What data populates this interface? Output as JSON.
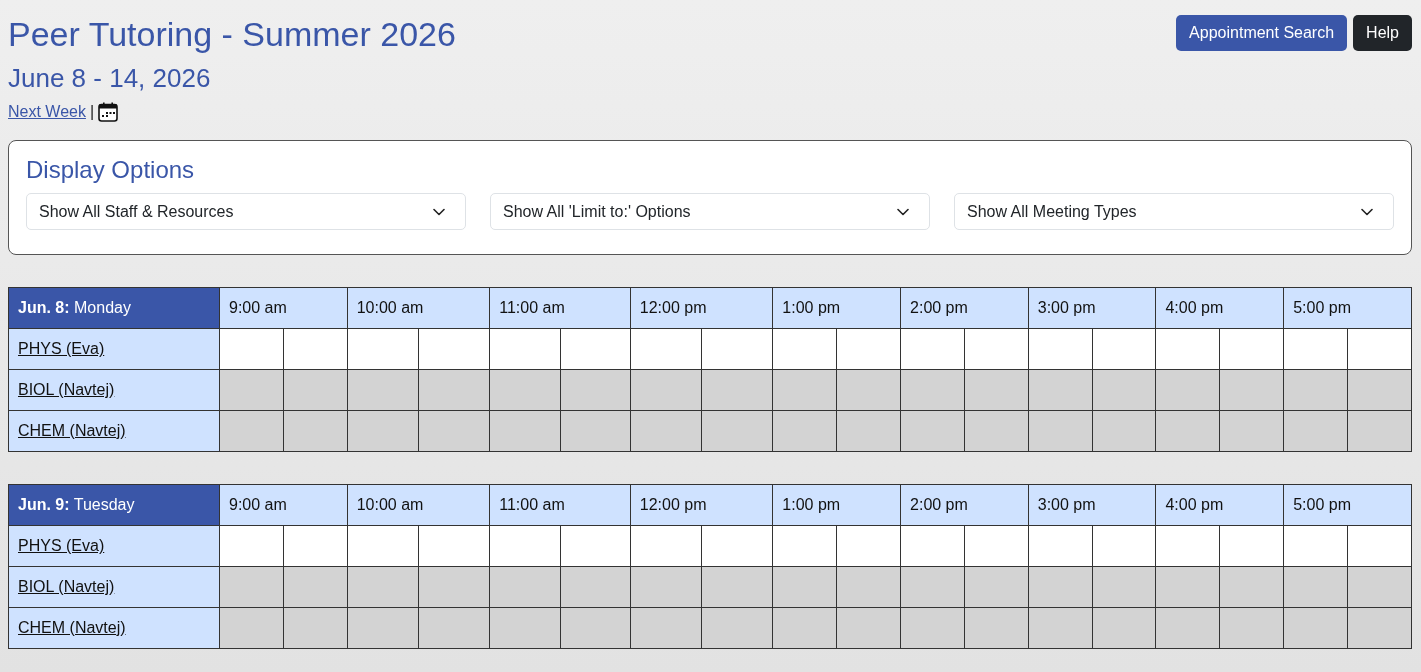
{
  "header": {
    "title": "Peer Tutoring - Summer 2026",
    "date_range": "June 8 - 14, 2026",
    "nav_link": "Next Week",
    "separator": "|"
  },
  "buttons": [
    {
      "label": "Appointment Search",
      "kind": "primary"
    },
    {
      "label": "Help",
      "kind": "dark"
    }
  ],
  "display_options": {
    "title": "Display Options",
    "filters": [
      {
        "value": "Show All Staff & Resources"
      },
      {
        "value": "Show All 'Limit to:' Options"
      },
      {
        "value": "Show All Meeting Types"
      }
    ]
  },
  "days": [
    {
      "date_label": "**Jun. 8:** Monday",
      "times": [
        "9:00 am",
        "10:00 am",
        "11:00 am",
        "12:00 pm",
        "1:00 pm",
        "2:00 pm",
        "3:00 pm",
        "4:00 pm",
        "5:00 pm"
      ],
      "rows": [
        {
          "label": "PHYS (Eva)",
          "slots": [
            {
              "available": true
            },
            {
              "available": true
            },
            {
              "available": true
            },
            {
              "available": true
            },
            {
              "available": true
            },
            {
              "available": true
            },
            {
              "available": true
            },
            {
              "available": true
            },
            {
              "available": true
            },
            {
              "available": true
            },
            {
              "available": true
            },
            {
              "available": true
            },
            {
              "available": true
            },
            {
              "available": true
            },
            {
              "available": true
            },
            {
              "available": true
            },
            {
              "available": true
            },
            {
              "available": true
            }
          ]
        },
        {
          "label": "BIOL (Navtej)",
          "slots": [
            {
              "available": false
            },
            {
              "available": false
            },
            {
              "available": false
            },
            {
              "available": false
            },
            {
              "available": false
            },
            {
              "available": false
            },
            {
              "available": false
            },
            {
              "available": false
            },
            {
              "available": false
            },
            {
              "available": false
            },
            {
              "available": false
            },
            {
              "available": false
            },
            {
              "available": false
            },
            {
              "available": false
            },
            {
              "available": false
            },
            {
              "available": false
            },
            {
              "available": false
            },
            {
              "available": false
            }
          ]
        },
        {
          "label": "CHEM (Navtej)",
          "slots": [
            {
              "available": false
            },
            {
              "available": false
            },
            {
              "available": false
            },
            {
              "available": false
            },
            {
              "available": false
            },
            {
              "available": false
            },
            {
              "available": false
            },
            {
              "available": false
            },
            {
              "available": false
            },
            {
              "available": false
            },
            {
              "available": false
            },
            {
              "available": false
            },
            {
              "available": false
            },
            {
              "available": false
            },
            {
              "available": false
            },
            {
              "available": false
            },
            {
              "available": false
            },
            {
              "available": false
            }
          ]
        }
      ]
    },
    {
      "date_label": "**Jun. 9:** Tuesday",
      "times": [
        "9:00 am",
        "10:00 am",
        "11:00 am",
        "12:00 pm",
        "1:00 pm",
        "2:00 pm",
        "3:00 pm",
        "4:00 pm",
        "5:00 pm"
      ],
      "rows": [
        {
          "label": "PHYS (Eva)",
          "slots": [
            {
              "available": true
            },
            {
              "available": true
            },
            {
              "available": true
            },
            {
              "available": true
            },
            {
              "available": true
            },
            {
              "available": true
            },
            {
              "available": true
            },
            {
              "available": true
            },
            {
              "available": true
            },
            {
              "available": true
            },
            {
              "available": true
            },
            {
              "available": true
            },
            {
              "available": true
            },
            {
              "available": true
            },
            {
              "available": true
            },
            {
              "available": true
            },
            {
              "available": true
            },
            {
              "available": true
            }
          ]
        },
        {
          "label": "BIOL (Navtej)",
          "slots": [
            {
              "available": false
            },
            {
              "available": false
            },
            {
              "available": false
            },
            {
              "available": false
            },
            {
              "available": false
            },
            {
              "available": false
            },
            {
              "available": false
            },
            {
              "available": false
            },
            {
              "available": false
            },
            {
              "available": false
            },
            {
              "available": false
            },
            {
              "available": false
            },
            {
              "available": false
            },
            {
              "available": false
            },
            {
              "available": false
            },
            {
              "available": false
            },
            {
              "available": false
            },
            {
              "available": false
            }
          ]
        },
        {
          "label": "CHEM (Navtej)",
          "slots": [
            {
              "available": false
            },
            {
              "available": false
            },
            {
              "available": false
            },
            {
              "available": false
            },
            {
              "available": false
            },
            {
              "available": false
            },
            {
              "available": false
            },
            {
              "available": false
            },
            {
              "available": false
            },
            {
              "available": false
            },
            {
              "available": false
            },
            {
              "available": false
            },
            {
              "available": false
            },
            {
              "available": false
            },
            {
              "available": false
            },
            {
              "available": false
            },
            {
              "available": false
            },
            {
              "available": false
            }
          ]
        }
      ]
    }
  ]
}
